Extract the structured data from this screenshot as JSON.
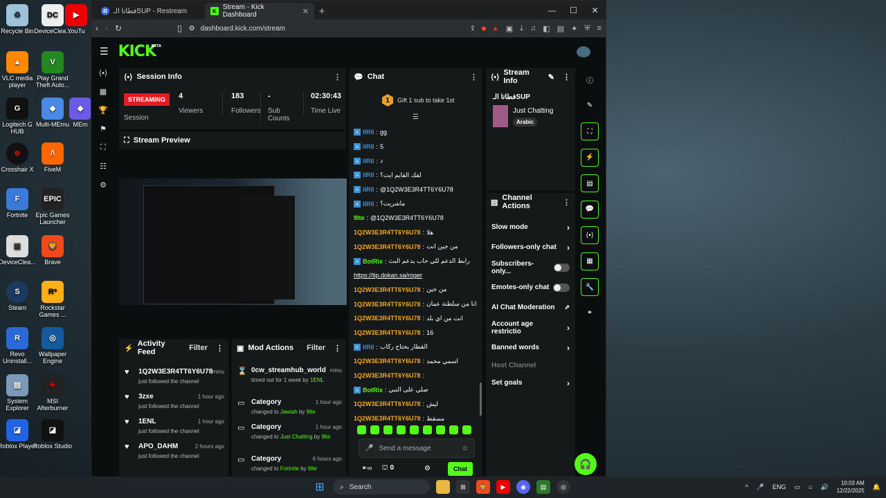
{
  "desktop": {
    "icons": [
      {
        "label": "Recycle Bin",
        "name": "recycle-bin-icon"
      },
      {
        "label": "DeviceClea...",
        "name": "device-cleanup-icon"
      },
      {
        "label": "YouTu",
        "name": "youtube-icon"
      },
      {
        "label": "VLC media player",
        "name": "vlc-icon"
      },
      {
        "label": "Play Grand Theft Auto...",
        "name": "gta-icon"
      },
      {
        "label": "Logitech G HUB",
        "name": "logitech-ghub-icon"
      },
      {
        "label": "Multi-MEmu",
        "name": "multi-memu-icon"
      },
      {
        "label": "MEm",
        "name": "memu-icon"
      },
      {
        "label": "Crosshair X",
        "name": "crosshair-x-icon"
      },
      {
        "label": "FiveM",
        "name": "fivem-icon"
      },
      {
        "label": "Fortnite",
        "name": "fortnite-icon"
      },
      {
        "label": "Epic Games Launcher",
        "name": "epic-games-icon"
      },
      {
        "label": "DeviceClea...",
        "name": "device-cleanup-2-icon"
      },
      {
        "label": "Brave",
        "name": "brave-icon"
      },
      {
        "label": "Steam",
        "name": "steam-icon"
      },
      {
        "label": "Rockstar Games ...",
        "name": "rockstar-icon"
      },
      {
        "label": "Revo Uninstall...",
        "name": "revo-uninstaller-icon"
      },
      {
        "label": "Wallpaper Engine",
        "name": "wallpaper-engine-icon"
      },
      {
        "label": "System Explorer",
        "name": "system-explorer-icon"
      },
      {
        "label": "MSI Afterburner",
        "name": "msi-afterburner-icon"
      },
      {
        "label": "Roblox Player",
        "name": "roblox-player-icon"
      },
      {
        "label": "Roblox Studio",
        "name": "roblox-studio-icon"
      }
    ]
  },
  "browser": {
    "tabs": [
      {
        "title": "فطاتا الـSUP - Restream",
        "favicon": "R"
      },
      {
        "title": "Stream - Kick Dashboard",
        "favicon": "K"
      }
    ],
    "new_tab": "+",
    "url": "dashboard.kick.com/stream"
  },
  "kick": {
    "logo": "KICK",
    "logo_sup": "BETA",
    "session": {
      "title": "Session Info",
      "status": "STREAMING",
      "status_label": "Session",
      "viewers": "4",
      "viewers_label": "Viewers",
      "followers": "183",
      "followers_label": "Followers",
      "subs": "-",
      "subs_label": "Sub Counts",
      "time": "02:30:43",
      "time_label": "Time Live"
    },
    "preview_title": "Stream Preview",
    "activity": {
      "title": "Activity Feed",
      "filter": "Filter",
      "items": [
        {
          "user": "1Q2W3E3R4TT6Y6U78",
          "text": "just followed the channel",
          "time": "minu"
        },
        {
          "user": "3zxe",
          "text": "just followed the channel",
          "time": "1 hour ago"
        },
        {
          "user": "1ENL",
          "text": "just followed the channel",
          "time": "1 hour ago"
        },
        {
          "user": "APO_DAHM",
          "text": "just followed the channel",
          "time": "2 hours ago"
        }
      ]
    },
    "mod": {
      "title": "Mod Actions",
      "filter": "Filter",
      "items": [
        {
          "title": "0cw_streamhub_world",
          "pre": "timed out for 1 week by",
          "who": "1ENL",
          "time": "minu"
        },
        {
          "title": "Category",
          "pre": "changed to",
          "val": "Jawlah",
          "by": "by",
          "who": "9lte",
          "time": "1 hour ago"
        },
        {
          "title": "Category",
          "pre": "changed to",
          "val": "Just Chatting",
          "by": "by",
          "who": "9lte",
          "time": "1 hour ago"
        },
        {
          "title": "Category",
          "pre": "changed to",
          "val": "Fortnite",
          "by": "by",
          "who": "9lte",
          "time": "6 hours ago"
        }
      ]
    },
    "chat": {
      "title": "Chat",
      "gift": "Gift 1 sub to take 1st",
      "placeholder": "Send a message",
      "send": "Chat",
      "kicks": "0",
      "messages": [
        {
          "user": "IIRII",
          "color": "#3b8fd1",
          "msg": "gg",
          "badge": true
        },
        {
          "user": "IIRII",
          "color": "#3b8fd1",
          "msg": "5",
          "badge": true
        },
        {
          "user": "IIRII",
          "color": "#3b8fd1",
          "msg": "د",
          "badge": true
        },
        {
          "user": "IIRII",
          "color": "#3b8fd1",
          "msg": "لفك القايم ايت؟",
          "badge": true
        },
        {
          "user": "IIRII",
          "color": "#3b8fd1",
          "msg": "@1Q2W3E3R4TT6Y6U78",
          "badge": true
        },
        {
          "user": "IIRII",
          "color": "#3b8fd1",
          "msg": "ماشريت؟",
          "badge": true
        },
        {
          "user": "9lte",
          "color": "#53fc18",
          "msg": "@1Q2W3E3R4TT6Y6U78",
          "badge": false
        },
        {
          "user": "1Q2W3E3R4TT6Y6U78",
          "color": "#f5a623",
          "msg": "هلا",
          "badge": false
        },
        {
          "user": "1Q2W3E3R4TT6Y6U78",
          "color": "#f5a623",
          "msg": "من جين انت",
          "badge": false
        },
        {
          "user": "BotRix",
          "color": "#53fc18",
          "msg": "رابط الدعم للي حاب يدعم البث",
          "badge": true
        },
        {
          "user": "",
          "color": "#fff",
          "msg": "https://tip.dokan.sa/roger",
          "badge": false
        },
        {
          "user": "1Q2W3E3R4TT6Y6U78",
          "color": "#f5a623",
          "msg": "من جين",
          "badge": false
        },
        {
          "user": "1Q2W3E3R4TT6Y6U78",
          "color": "#f5a623",
          "msg": "انا من سلطنة عمان",
          "badge": false
        },
        {
          "user": "1Q2W3E3R4TT6Y6U78",
          "color": "#f5a623",
          "msg": "انت من اي بلد",
          "badge": false
        },
        {
          "user": "1Q2W3E3R4TT6Y6U78",
          "color": "#f5a623",
          "msg": "16",
          "badge": false
        },
        {
          "user": "IIRII",
          "color": "#3b8fd1",
          "msg": "القطار يحتاج ركاب",
          "badge": true
        },
        {
          "user": "1Q2W3E3R4TT6Y6U78",
          "color": "#f5a623",
          "msg": "اسمي محمد",
          "badge": false
        },
        {
          "user": "1Q2W3E3R4TT6Y6U78",
          "color": "#f5a623",
          "msg": "",
          "badge": false
        },
        {
          "user": "BotRix",
          "color": "#53fc18",
          "msg": "صلي على النبي",
          "badge": true
        },
        {
          "user": "1Q2W3E3R4TT6Y6U78",
          "color": "#f5a623",
          "msg": "ليش",
          "badge": false
        },
        {
          "user": "1Q2W3E3R4TT6Y6U78",
          "color": "#f5a623",
          "msg": "مسقط",
          "badge": false
        }
      ]
    },
    "stream_info": {
      "title": "Stream Info",
      "stream_title": "فطاتا الـSUP",
      "category": "Just Chatting",
      "language": "Arabic"
    },
    "channel_actions": {
      "title": "Channel Actions",
      "items": [
        {
          "label": "Slow mode",
          "kind": "arrow"
        },
        {
          "label": "Followers-only chat",
          "kind": "arrow"
        },
        {
          "label": "Subscribers-only...",
          "kind": "toggle"
        },
        {
          "label": "Emotes-only chat",
          "kind": "toggle"
        },
        {
          "label": "AI Chat Moderation",
          "kind": "ext"
        },
        {
          "label": "Account age restrictio",
          "kind": "arrow"
        },
        {
          "label": "Banned words",
          "kind": "arrow"
        },
        {
          "label": "Host Channel",
          "kind": "disabled"
        },
        {
          "label": "Set goals",
          "kind": "arrow"
        }
      ]
    }
  },
  "taskbar": {
    "search": "Search",
    "lang": "ENG",
    "time": "10:03 AM",
    "date": "12/22/2025"
  }
}
